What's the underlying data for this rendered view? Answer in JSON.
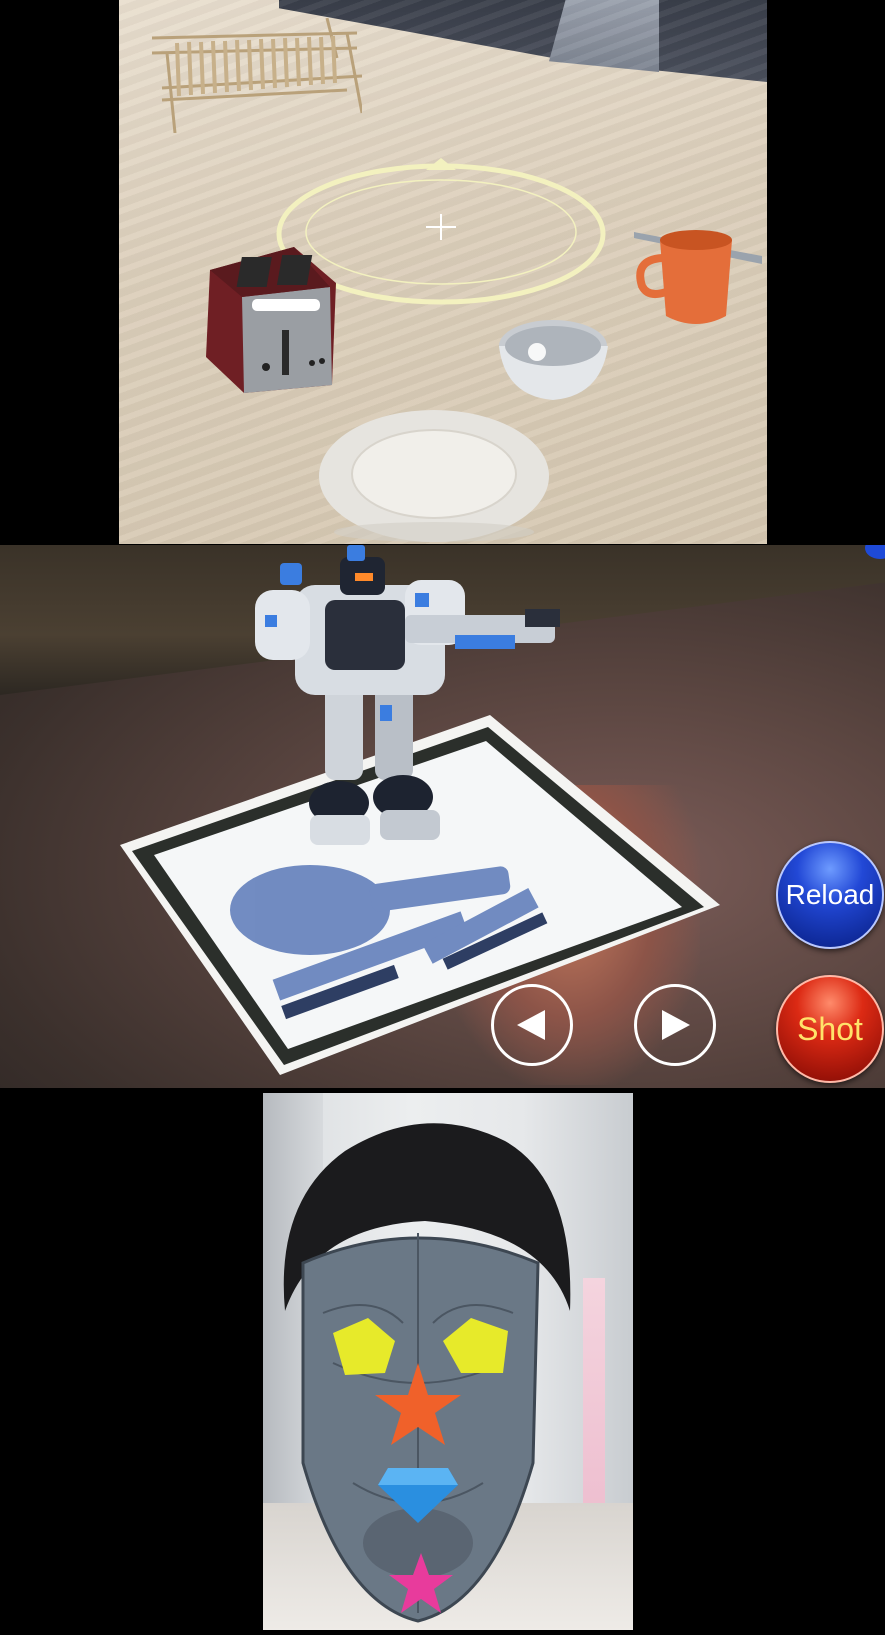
{
  "panels": {
    "top": {
      "scene": "ar-kitchen-table"
    },
    "middle": {
      "scene": "ar-marker-robot",
      "buttons": {
        "reload_label": "Reload",
        "shot_label": "Shot",
        "prev_icon": "left-triangle-icon",
        "next_icon": "right-triangle-icon"
      }
    },
    "bottom": {
      "scene": "ar-face-mask"
    }
  },
  "colors": {
    "reload_button": "#1f45d4",
    "shot_button": "#d42a14",
    "shot_text": "#ffe36a",
    "reticle": "#f3f1bf",
    "mug": "#e46e3a",
    "mask_eyes": "#e7ea2a",
    "mask_nose_star": "#f0612a",
    "mask_gem": "#2a8fe0",
    "mask_chin_star": "#e83b9c"
  }
}
